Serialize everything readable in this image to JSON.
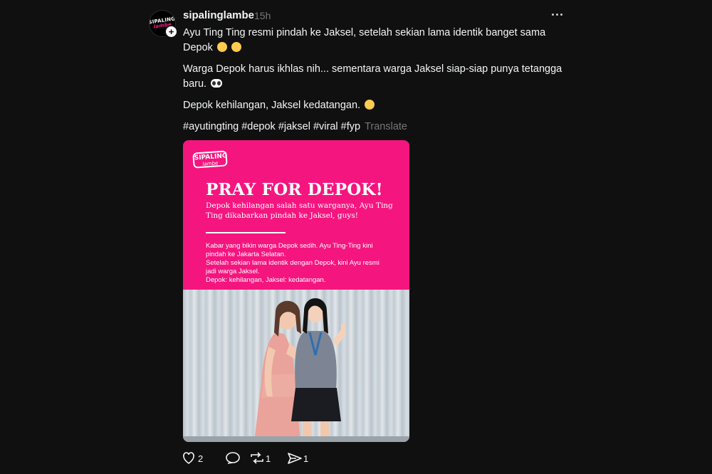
{
  "post": {
    "username": "sipalinglambe",
    "time": "15h",
    "avatar_text_1": "SIPALING",
    "avatar_text_2": "lambe",
    "caption": {
      "line1": "Ayu Ting Ting resmi pindah ke Jaksel, setelah sekian lama identik banget sama Depok",
      "line2": "Warga Depok harus ikhlas nih... sementara warga Jaksel siap-siap punya tetangga baru.",
      "line3": "Depok kehilangan, Jaksel kedatangan.",
      "hashtags": "#ayutingting #depok #jaksel #viral #fyp",
      "translate": "Translate"
    },
    "icons": {
      "more": "more-icon",
      "follow": "plus-icon",
      "like": "heart-icon",
      "reply": "comment-icon",
      "repost": "repost-icon",
      "share": "send-icon"
    }
  },
  "image_card": {
    "logo_text_1": "SIPALING",
    "logo_text_2": "lambe",
    "headline": "PRAY FOR DEPOK!",
    "subhead": "Depok kehilangan salah satu warganya, Ayu Ting Ting dikabarkan pindah ke Jaksel, guys!",
    "body": [
      "Kabar yang bikin warga Depok sedih. Ayu Ting-Ting kini pindah ke Jakarta Selatan.",
      "Setelah sekian lama identik dengan Depok, kini Ayu resmi jadi warga Jaksel.",
      "Depok: kehilangan, Jaksel: kedatangan."
    ],
    "accent_color": "#f5157f"
  },
  "actions": {
    "likes": "2",
    "replies": "",
    "reposts": "1",
    "shares": "1"
  }
}
